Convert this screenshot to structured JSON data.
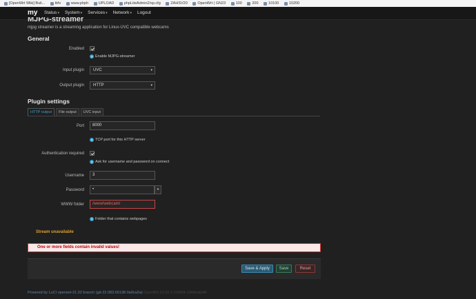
{
  "bookmarks": [
    "[OpenWrt Wiki] Buil...",
    "tkfv",
    "www.phph",
    "UPLOAD",
    "phpLiteAdmin2/sp.cfg",
    "ZAHSV20",
    "OpenWrt | GN23",
    "100",
    "200",
    "10100",
    "10200"
  ],
  "navbar": {
    "brand": "my",
    "menu": [
      {
        "label": "Status",
        "caret": "▾"
      },
      {
        "label": "System",
        "caret": "▾"
      },
      {
        "label": "Services",
        "caret": "▾"
      },
      {
        "label": "Network",
        "caret": "▾"
      },
      {
        "label": "Logout",
        "caret": ""
      }
    ]
  },
  "page": {
    "title": "MJPG-streamer",
    "description": "mjpg streamer is a streaming application for Linux-UVC compatible webcams"
  },
  "general": {
    "heading": "General",
    "enabled_label": "Enabled",
    "enabled_help": "Enable MJPG-streamer",
    "input_plugin_label": "Input plugin",
    "input_plugin_value": "UVC",
    "output_plugin_label": "Output plugin",
    "output_plugin_value": "HTTP"
  },
  "plugin_settings": {
    "heading": "Plugin settings",
    "tabs": [
      "HTTP output",
      "File output",
      "UVC input"
    ],
    "port_label": "Port",
    "port_value": "8000",
    "port_help": "TCP port for this HTTP server",
    "auth_label": "Authentication required",
    "auth_help": "Ask for username and password on connect",
    "username_label": "Username",
    "username_value": "3",
    "password_label": "Password",
    "password_value": "•",
    "www_label": "WWW folder",
    "www_value": "/www/webcam/",
    "www_help": "Folder that contains webpages"
  },
  "status": {
    "stream": "Stream unavailable",
    "alert": "One or more fields contain invalid values!"
  },
  "buttons": {
    "save_apply": "Save & Apply",
    "save": "Save",
    "reset": "Reset"
  },
  "footer": {
    "powered": "Powered by LuCI openwrt-21.02 branch (git-22.083.69138-0a0ca2a)",
    "version": "OpenWrt 21.02.3 r16554-1d4dea6d4f"
  },
  "icons": {
    "help": "?",
    "dropdown": "▾",
    "reveal": "∗"
  },
  "colors": {
    "accent": "#3aa0c9",
    "warning": "#e0a030",
    "error": "#d33"
  }
}
